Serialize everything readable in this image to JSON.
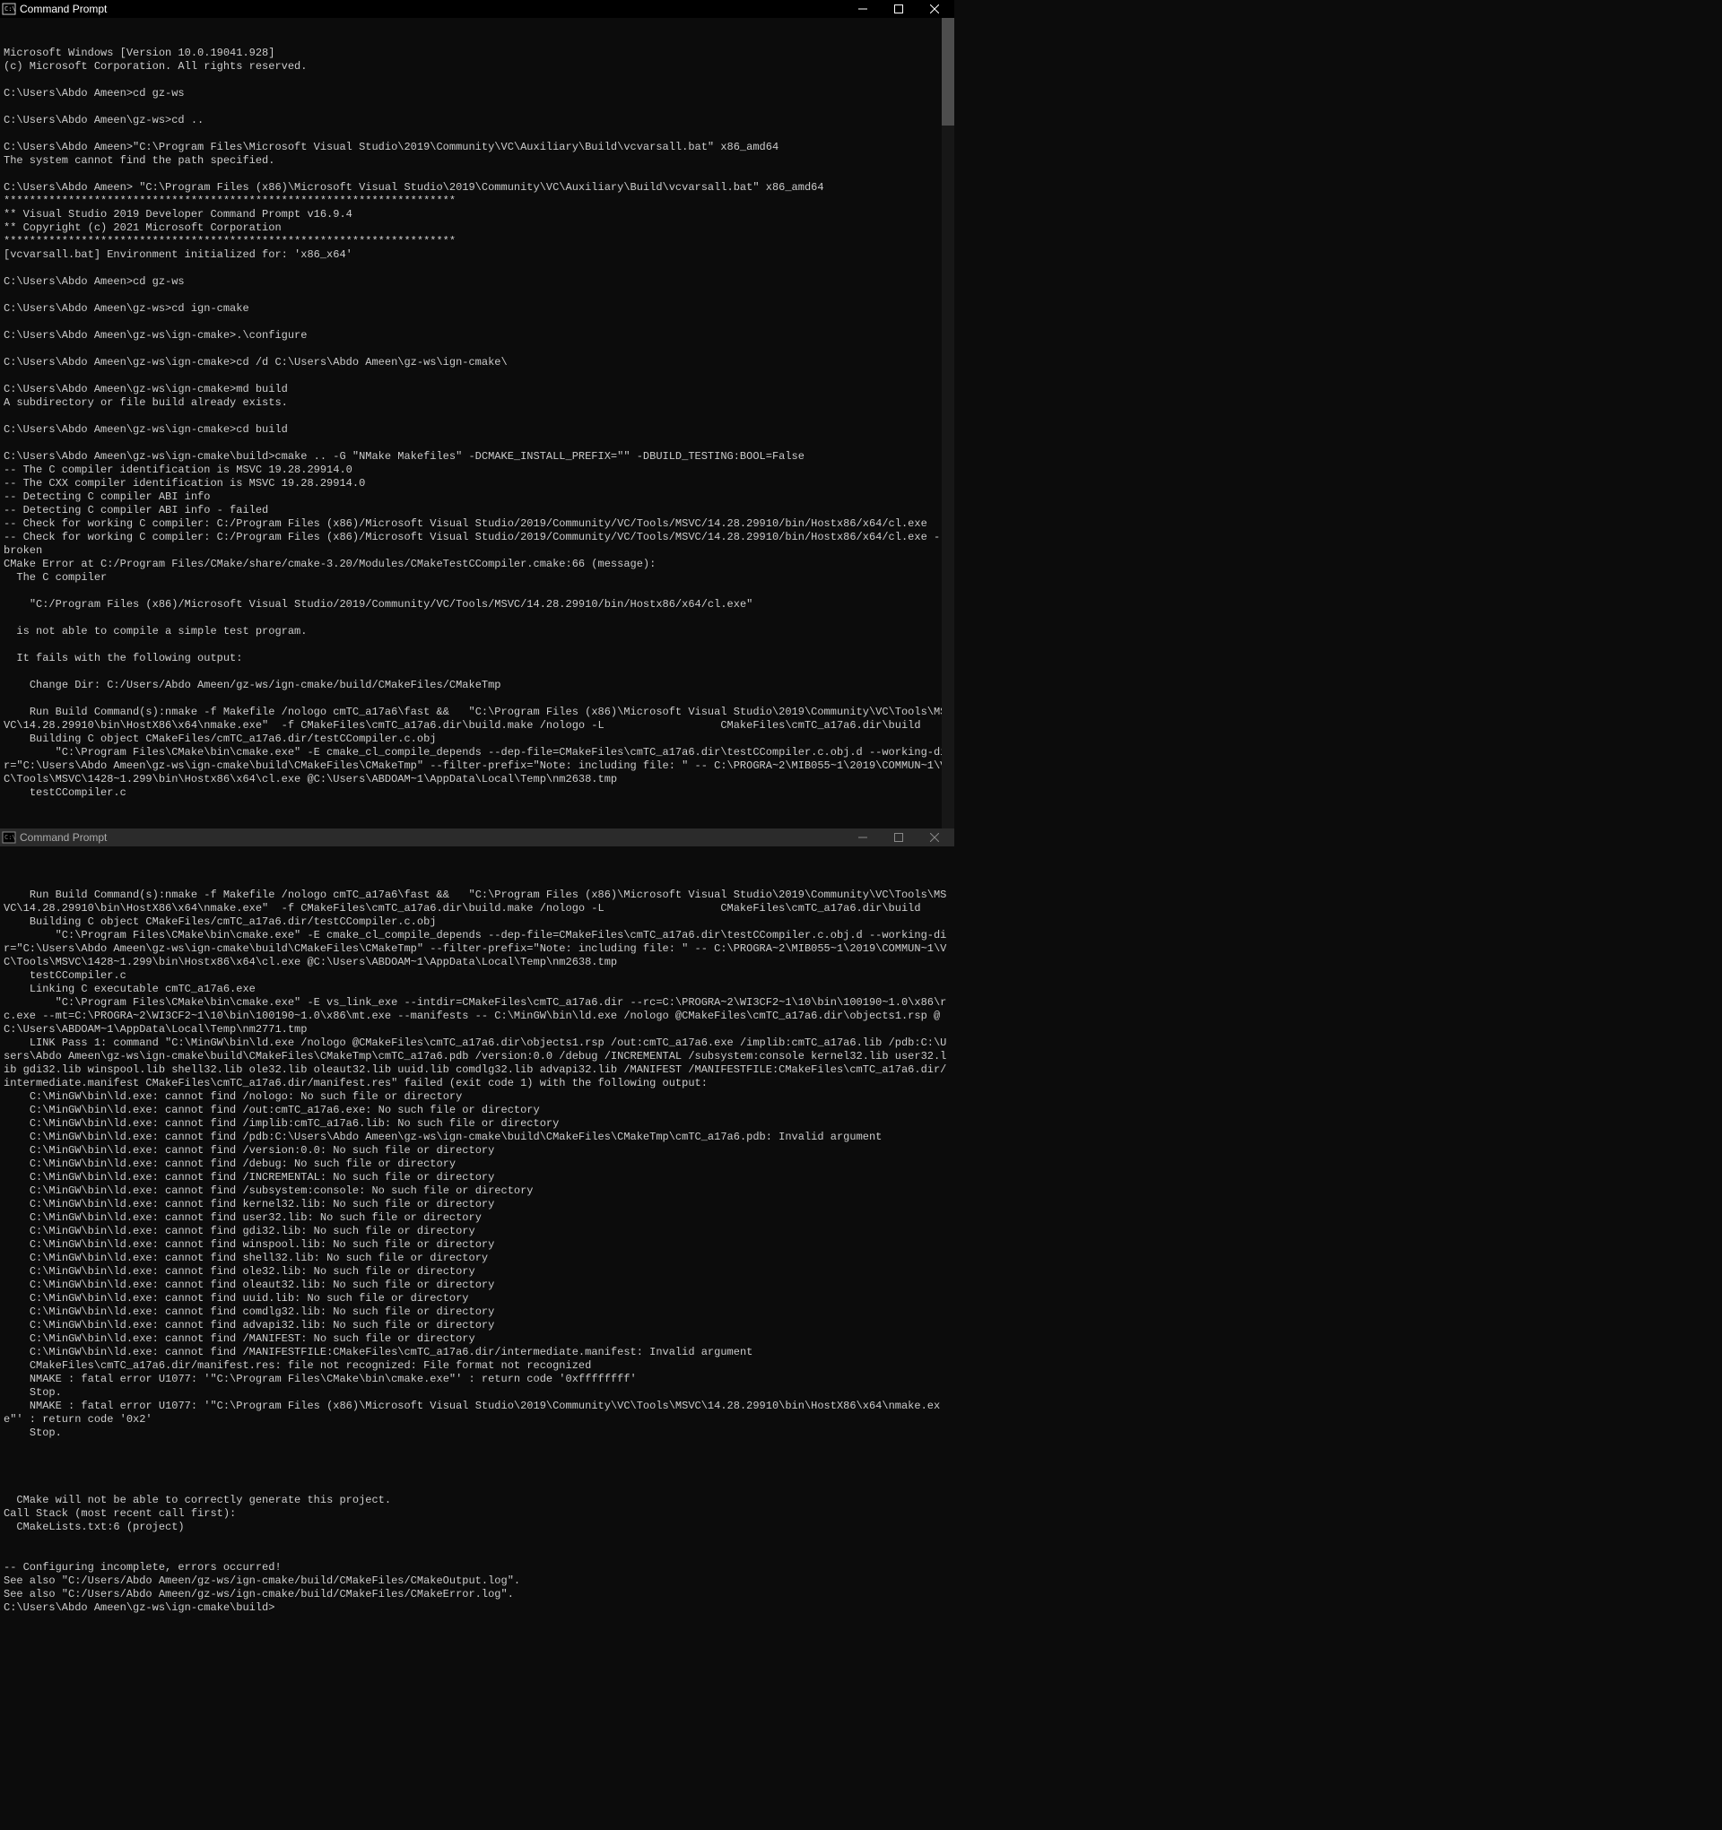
{
  "window1": {
    "title": "Command Prompt",
    "lines": [
      "Microsoft Windows [Version 10.0.19041.928]",
      "(c) Microsoft Corporation. All rights reserved.",
      "",
      "C:\\Users\\Abdo Ameen>cd gz-ws",
      "",
      "C:\\Users\\Abdo Ameen\\gz-ws>cd ..",
      "",
      "C:\\Users\\Abdo Ameen>\"C:\\Program Files\\Microsoft Visual Studio\\2019\\Community\\VC\\Auxiliary\\Build\\vcvarsall.bat\" x86_amd64",
      "The system cannot find the path specified.",
      "",
      "C:\\Users\\Abdo Ameen> \"C:\\Program Files (x86)\\Microsoft Visual Studio\\2019\\Community\\VC\\Auxiliary\\Build\\vcvarsall.bat\" x86_amd64",
      "**********************************************************************",
      "** Visual Studio 2019 Developer Command Prompt v16.9.4",
      "** Copyright (c) 2021 Microsoft Corporation",
      "**********************************************************************",
      "[vcvarsall.bat] Environment initialized for: 'x86_x64'",
      "",
      "C:\\Users\\Abdo Ameen>cd gz-ws",
      "",
      "C:\\Users\\Abdo Ameen\\gz-ws>cd ign-cmake",
      "",
      "C:\\Users\\Abdo Ameen\\gz-ws\\ign-cmake>.\\configure",
      "",
      "C:\\Users\\Abdo Ameen\\gz-ws\\ign-cmake>cd /d C:\\Users\\Abdo Ameen\\gz-ws\\ign-cmake\\",
      "",
      "C:\\Users\\Abdo Ameen\\gz-ws\\ign-cmake>md build",
      "A subdirectory or file build already exists.",
      "",
      "C:\\Users\\Abdo Ameen\\gz-ws\\ign-cmake>cd build",
      "",
      "C:\\Users\\Abdo Ameen\\gz-ws\\ign-cmake\\build>cmake .. -G \"NMake Makefiles\" -DCMAKE_INSTALL_PREFIX=\"\" -DBUILD_TESTING:BOOL=False",
      "-- The C compiler identification is MSVC 19.28.29914.0",
      "-- The CXX compiler identification is MSVC 19.28.29914.0",
      "-- Detecting C compiler ABI info",
      "-- Detecting C compiler ABI info - failed",
      "-- Check for working C compiler: C:/Program Files (x86)/Microsoft Visual Studio/2019/Community/VC/Tools/MSVC/14.28.29910/bin/Hostx86/x64/cl.exe",
      "-- Check for working C compiler: C:/Program Files (x86)/Microsoft Visual Studio/2019/Community/VC/Tools/MSVC/14.28.29910/bin/Hostx86/x64/cl.exe - broken",
      "CMake Error at C:/Program Files/CMake/share/cmake-3.20/Modules/CMakeTestCCompiler.cmake:66 (message):",
      "  The C compiler",
      "",
      "    \"C:/Program Files (x86)/Microsoft Visual Studio/2019/Community/VC/Tools/MSVC/14.28.29910/bin/Hostx86/x64/cl.exe\"",
      "",
      "  is not able to compile a simple test program.",
      "",
      "  It fails with the following output:",
      "",
      "    Change Dir: C:/Users/Abdo Ameen/gz-ws/ign-cmake/build/CMakeFiles/CMakeTmp",
      "",
      "    Run Build Command(s):nmake -f Makefile /nologo cmTC_a17a6\\fast &&   \"C:\\Program Files (x86)\\Microsoft Visual Studio\\2019\\Community\\VC\\Tools\\MSVC\\14.28.29910\\bin\\HostX86\\x64\\nmake.exe\"  -f CMakeFiles\\cmTC_a17a6.dir\\build.make /nologo -L                  CMakeFiles\\cmTC_a17a6.dir\\build",
      "    Building C object CMakeFiles/cmTC_a17a6.dir/testCCompiler.c.obj",
      "        \"C:\\Program Files\\CMake\\bin\\cmake.exe\" -E cmake_cl_compile_depends --dep-file=CMakeFiles\\cmTC_a17a6.dir\\testCCompiler.c.obj.d --working-dir=\"C:\\Users\\Abdo Ameen\\gz-ws\\ign-cmake\\build\\CMakeFiles\\CMakeTmp\" --filter-prefix=\"Note: including file: \" -- C:\\PROGRA~2\\MIB055~1\\2019\\COMMUN~1\\VC\\Tools\\MSVC\\1428~1.299\\bin\\Hostx86\\x64\\cl.exe @C:\\Users\\ABDOAM~1\\AppData\\Local\\Temp\\nm2638.tmp",
      "    testCCompiler.c"
    ]
  },
  "window2": {
    "title": "Command Prompt",
    "lines": [
      "",
      "    Run Build Command(s):nmake -f Makefile /nologo cmTC_a17a6\\fast &&   \"C:\\Program Files (x86)\\Microsoft Visual Studio\\2019\\Community\\VC\\Tools\\MSVC\\14.28.29910\\bin\\HostX86\\x64\\nmake.exe\"  -f CMakeFiles\\cmTC_a17a6.dir\\build.make /nologo -L                  CMakeFiles\\cmTC_a17a6.dir\\build",
      "    Building C object CMakeFiles/cmTC_a17a6.dir/testCCompiler.c.obj",
      "        \"C:\\Program Files\\CMake\\bin\\cmake.exe\" -E cmake_cl_compile_depends --dep-file=CMakeFiles\\cmTC_a17a6.dir\\testCCompiler.c.obj.d --working-dir=\"C:\\Users\\Abdo Ameen\\gz-ws\\ign-cmake\\build\\CMakeFiles\\CMakeTmp\" --filter-prefix=\"Note: including file: \" -- C:\\PROGRA~2\\MIB055~1\\2019\\COMMUN~1\\VC\\Tools\\MSVC\\1428~1.299\\bin\\Hostx86\\x64\\cl.exe @C:\\Users\\ABDOAM~1\\AppData\\Local\\Temp\\nm2638.tmp",
      "    testCCompiler.c",
      "    Linking C executable cmTC_a17a6.exe",
      "        \"C:\\Program Files\\CMake\\bin\\cmake.exe\" -E vs_link_exe --intdir=CMakeFiles\\cmTC_a17a6.dir --rc=C:\\PROGRA~2\\WI3CF2~1\\10\\bin\\100190~1.0\\x86\\rc.exe --mt=C:\\PROGRA~2\\WI3CF2~1\\10\\bin\\100190~1.0\\x86\\mt.exe --manifests -- C:\\MinGW\\bin\\ld.exe /nologo @CMakeFiles\\cmTC_a17a6.dir\\objects1.rsp @C:\\Users\\ABDOAM~1\\AppData\\Local\\Temp\\nm2771.tmp",
      "    LINK Pass 1: command \"C:\\MinGW\\bin\\ld.exe /nologo @CMakeFiles\\cmTC_a17a6.dir\\objects1.rsp /out:cmTC_a17a6.exe /implib:cmTC_a17a6.lib /pdb:C:\\Users\\Abdo Ameen\\gz-ws\\ign-cmake\\build\\CMakeFiles\\CMakeTmp\\cmTC_a17a6.pdb /version:0.0 /debug /INCREMENTAL /subsystem:console kernel32.lib user32.lib gdi32.lib winspool.lib shell32.lib ole32.lib oleaut32.lib uuid.lib comdlg32.lib advapi32.lib /MANIFEST /MANIFESTFILE:CMakeFiles\\cmTC_a17a6.dir/intermediate.manifest CMakeFiles\\cmTC_a17a6.dir/manifest.res\" failed (exit code 1) with the following output:",
      "    C:\\MinGW\\bin\\ld.exe: cannot find /nologo: No such file or directory",
      "    C:\\MinGW\\bin\\ld.exe: cannot find /out:cmTC_a17a6.exe: No such file or directory",
      "    C:\\MinGW\\bin\\ld.exe: cannot find /implib:cmTC_a17a6.lib: No such file or directory",
      "    C:\\MinGW\\bin\\ld.exe: cannot find /pdb:C:\\Users\\Abdo Ameen\\gz-ws\\ign-cmake\\build\\CMakeFiles\\CMakeTmp\\cmTC_a17a6.pdb: Invalid argument",
      "    C:\\MinGW\\bin\\ld.exe: cannot find /version:0.0: No such file or directory",
      "    C:\\MinGW\\bin\\ld.exe: cannot find /debug: No such file or directory",
      "    C:\\MinGW\\bin\\ld.exe: cannot find /INCREMENTAL: No such file or directory",
      "    C:\\MinGW\\bin\\ld.exe: cannot find /subsystem:console: No such file or directory",
      "    C:\\MinGW\\bin\\ld.exe: cannot find kernel32.lib: No such file or directory",
      "    C:\\MinGW\\bin\\ld.exe: cannot find user32.lib: No such file or directory",
      "    C:\\MinGW\\bin\\ld.exe: cannot find gdi32.lib: No such file or directory",
      "    C:\\MinGW\\bin\\ld.exe: cannot find winspool.lib: No such file or directory",
      "    C:\\MinGW\\bin\\ld.exe: cannot find shell32.lib: No such file or directory",
      "    C:\\MinGW\\bin\\ld.exe: cannot find ole32.lib: No such file or directory",
      "    C:\\MinGW\\bin\\ld.exe: cannot find oleaut32.lib: No such file or directory",
      "    C:\\MinGW\\bin\\ld.exe: cannot find uuid.lib: No such file or directory",
      "    C:\\MinGW\\bin\\ld.exe: cannot find comdlg32.lib: No such file or directory",
      "    C:\\MinGW\\bin\\ld.exe: cannot find advapi32.lib: No such file or directory",
      "    C:\\MinGW\\bin\\ld.exe: cannot find /MANIFEST: No such file or directory",
      "    C:\\MinGW\\bin\\ld.exe: cannot find /MANIFESTFILE:CMakeFiles\\cmTC_a17a6.dir/intermediate.manifest: Invalid argument",
      "    CMakeFiles\\cmTC_a17a6.dir/manifest.res: file not recognized: File format not recognized",
      "    NMAKE : fatal error U1077: '\"C:\\Program Files\\CMake\\bin\\cmake.exe\"' : return code '0xffffffff'",
      "    Stop.",
      "    NMAKE : fatal error U1077: '\"C:\\Program Files (x86)\\Microsoft Visual Studio\\2019\\Community\\VC\\Tools\\MSVC\\14.28.29910\\bin\\HostX86\\x64\\nmake.exe\"' : return code '0x2'",
      "    Stop.",
      "",
      "",
      "",
      "",
      "  CMake will not be able to correctly generate this project.",
      "Call Stack (most recent call first):",
      "  CMakeLists.txt:6 (project)",
      "",
      "",
      "-- Configuring incomplete, errors occurred!",
      "See also \"C:/Users/Abdo Ameen/gz-ws/ign-cmake/build/CMakeFiles/CMakeOutput.log\".",
      "See also \"C:/Users/Abdo Ameen/gz-ws/ign-cmake/build/CMakeFiles/CMakeError.log\".",
      "C:\\Users\\Abdo Ameen\\gz-ws\\ign-cmake\\build>"
    ]
  }
}
